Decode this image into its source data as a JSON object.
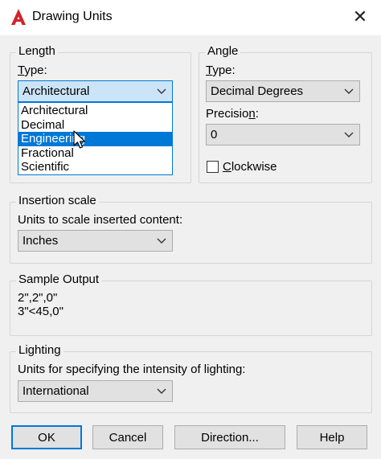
{
  "window": {
    "title": "Drawing Units",
    "close_glyph": "✕"
  },
  "length": {
    "group_label": "Length",
    "type_label": "Type:",
    "type_value": "Architectural",
    "dropdown_options": [
      "Architectural",
      "Decimal",
      "Engineering",
      "Fractional",
      "Scientific"
    ],
    "highlighted_option": "Engineering"
  },
  "angle": {
    "group_label": "Angle",
    "type_label": "Type:",
    "type_value": "Decimal Degrees",
    "precision_label": "Precision:",
    "precision_value": "0",
    "clockwise_label": "Clockwise",
    "clockwise_checked": false
  },
  "insertion_scale": {
    "group_label": "Insertion scale",
    "units_label": "Units to scale inserted content:",
    "units_value": "Inches"
  },
  "sample_output": {
    "group_label": "Sample Output",
    "lines": [
      "2\",2\",0\"",
      "3\"<45,0\""
    ]
  },
  "lighting": {
    "group_label": "Lighting",
    "units_label": "Units for specifying the intensity of lighting:",
    "units_value": "International"
  },
  "buttons": {
    "ok": "OK",
    "cancel": "Cancel",
    "direction": "Direction...",
    "help": "Help"
  },
  "colors": {
    "accent": "#0078d7",
    "app_icon_red": "#d2232a",
    "dialog_bg": "#f0f0f0"
  },
  "icons": {
    "app": "autocad-logo-icon",
    "close": "close-icon",
    "dropdown": "chevron-down-icon",
    "cursor": "mouse-pointer-icon"
  }
}
